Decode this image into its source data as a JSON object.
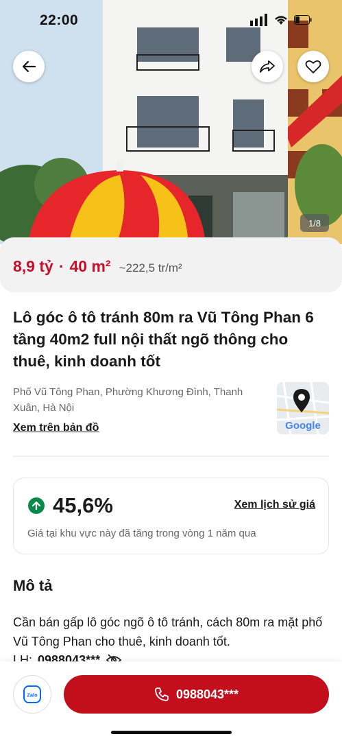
{
  "status": {
    "time": "22:00"
  },
  "gallery": {
    "counter": "1/8"
  },
  "listing": {
    "price": "8,9 tỷ",
    "separator": "·",
    "area": "40 m²",
    "price_per_m2": "~222,5 tr/m²",
    "title": "Lô góc ô tô tránh 80m ra Vũ Tông Phan 6 tầng 40m2 full nội thất ngõ thông cho thuê, kinh doanh tốt",
    "address": "Phố Vũ Tông Phan, Phường Khương Đình, Thanh Xuân, Hà Nội",
    "map_link": "Xem trên bản đồ",
    "map_brand": "Google"
  },
  "price_trend": {
    "value": "45,6%",
    "history_link": "Xem lịch sử giá",
    "description": "Giá tại khu vực này đã tăng trong vòng 1 năm qua"
  },
  "description": {
    "heading": "Mô tả",
    "text": "Cần bán gấp lô góc ngõ ô tô tránh, cách 80m ra mặt phố Vũ Tông Phan cho thuê, kinh doanh tốt.",
    "phone_label": "LH:",
    "phone": "0988043***"
  },
  "actions": {
    "zalo_label": "Zalo",
    "call_label": "0988043***"
  },
  "colors": {
    "accent": "#c30f1c",
    "trend_up": "#0a8a4a"
  },
  "icons": [
    "back-arrow-icon",
    "share-icon",
    "heart-icon",
    "location-pin-icon",
    "arrow-up-icon",
    "eye-off-icon",
    "phone-icon",
    "zalo-icon"
  ]
}
